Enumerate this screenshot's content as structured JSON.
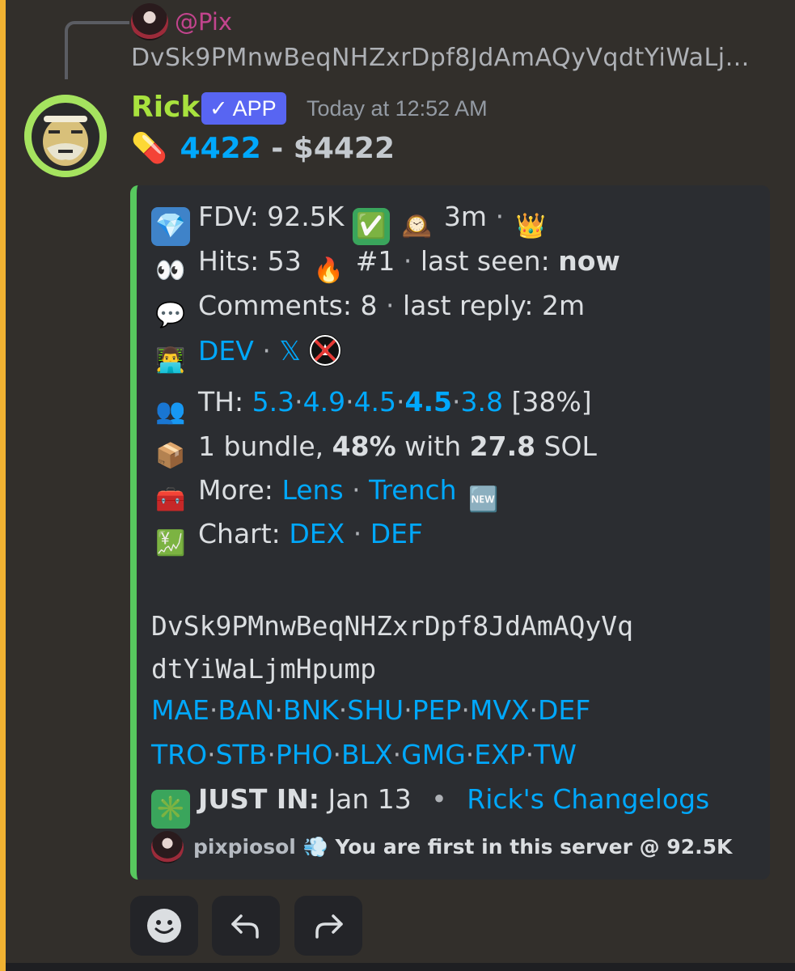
{
  "reply": {
    "username": "@Pix",
    "preview": "DvSk9PMnwBeqNHZxrDpf8JdAmAQyVqdtYiWaLj…"
  },
  "message": {
    "author": "Rick",
    "badge": "✓ APP",
    "timestamp": "Today at 12:52 AM",
    "title_emoji": "💊",
    "title_ticker": "4422",
    "title_sep": " - ",
    "title_symbol": "$4422"
  },
  "embed": {
    "accent_color": "#57c85e",
    "line1": {
      "icon": "💎",
      "label": "FDV: 92.5K",
      "check": "✅",
      "clock": "🕰️",
      "age": "3m",
      "dot": "·",
      "crown": "👑"
    },
    "line2": {
      "icon": "👀",
      "label": "Hits: 53",
      "fire": "🔥",
      "rank": "#1",
      "dot": "·",
      "seen_label": "last seen:",
      "seen_value": "now"
    },
    "line3": {
      "icon": "💬",
      "label": "Comments: 8",
      "dot": "·",
      "reply_label": "last reply: 2m"
    },
    "line4": {
      "icon": "👨‍💻",
      "dev": "DEV",
      "dot": "·",
      "x": "𝕏"
    },
    "line5": {
      "icon": "👥",
      "label": "TH:",
      "values": [
        "5.3",
        "4.9",
        "4.5",
        "4.5",
        "3.8"
      ],
      "sep": "·",
      "percent": "[38%]"
    },
    "line6": {
      "icon": "📦",
      "pre": "1 bundle, ",
      "pct": "48%",
      "mid": " with ",
      "sol": "27.8",
      "post": " SOL"
    },
    "line7": {
      "icon": "🧰",
      "label": "More:",
      "lens": "Lens",
      "dot": "·",
      "trench": "Trench",
      "new": "🆕"
    },
    "line8": {
      "icon": "💹",
      "label": "Chart:",
      "dex": "DEX",
      "dot": "·",
      "def": "DEF"
    },
    "address_line1": "DvSk9PMnwBeqNHZxrDpf8JdAmAQyVq",
    "address_line2": "dtYiWaLjmHpump",
    "links_row1": [
      "MAE",
      "BAN",
      "BNK",
      "SHU",
      "PEP",
      "MVX",
      "DEF"
    ],
    "links_row2": [
      "TRO",
      "STB",
      "PHO",
      "BLX",
      "GMG",
      "EXP",
      "TW"
    ],
    "link_sep": "·",
    "just_in": {
      "icon": "✳️",
      "label": "JUST IN:",
      "date": "Jan 13",
      "bullet": "•",
      "link": "Rick's Changelogs"
    },
    "footer": {
      "user": "pixpiosol",
      "emoji": "💨",
      "text": "You are first in this server @ 92.5K"
    }
  },
  "actions": [
    {
      "name": "add-reaction-icon"
    },
    {
      "name": "reply-icon"
    },
    {
      "name": "forward-icon"
    }
  ]
}
